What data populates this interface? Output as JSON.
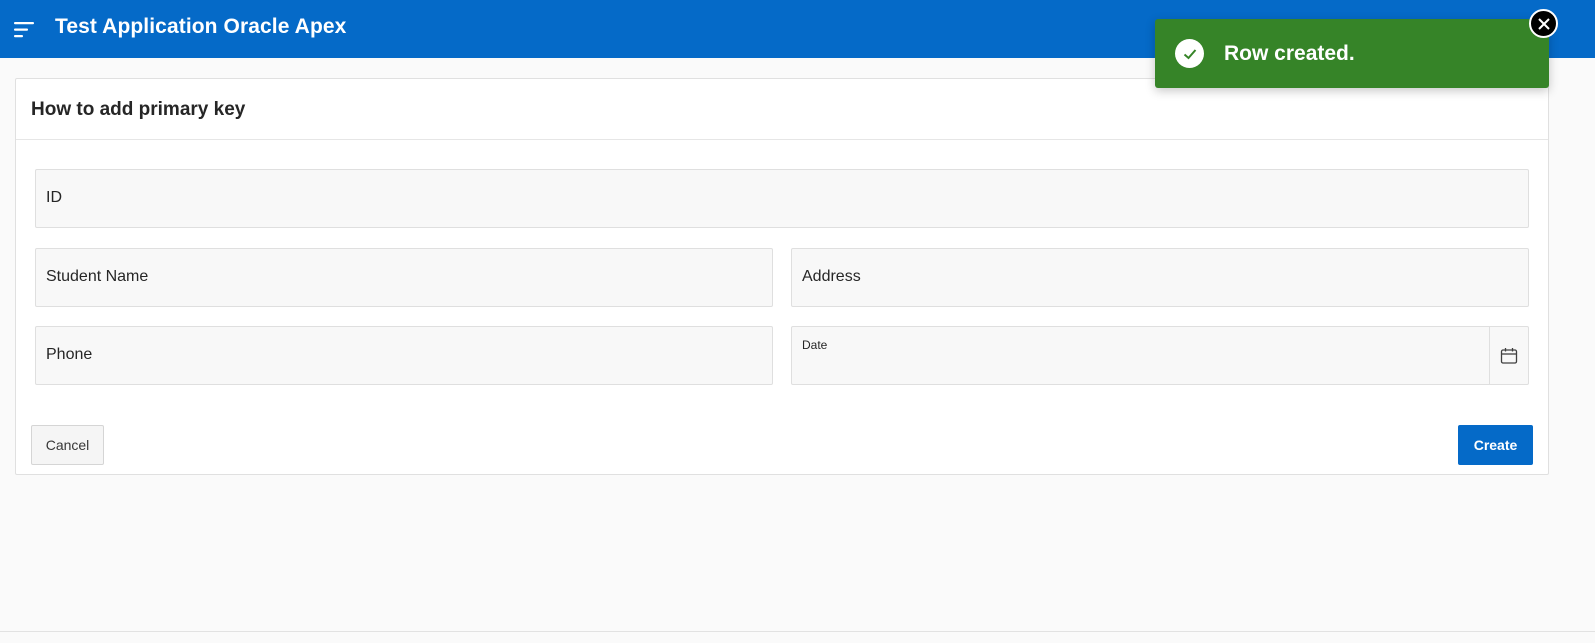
{
  "header": {
    "title": "Test Application Oracle Apex",
    "menu_icon": "hamburger-menu-icon",
    "background_color": "#056ac8"
  },
  "region": {
    "title": "How to add primary key"
  },
  "form": {
    "fields": {
      "id": {
        "label": "ID",
        "value": ""
      },
      "student_name": {
        "label": "Student Name",
        "value": ""
      },
      "address": {
        "label": "Address",
        "value": ""
      },
      "phone": {
        "label": "Phone",
        "value": ""
      },
      "date": {
        "label": "Date",
        "value": "",
        "icon": "calendar-icon"
      }
    }
  },
  "buttons": {
    "cancel_label": "Cancel",
    "create_label": "Create",
    "create_color": "#056ac8"
  },
  "alert": {
    "message": "Row created.",
    "icon": "check-circle-icon",
    "close_icon": "close-icon",
    "color": "#368428"
  }
}
